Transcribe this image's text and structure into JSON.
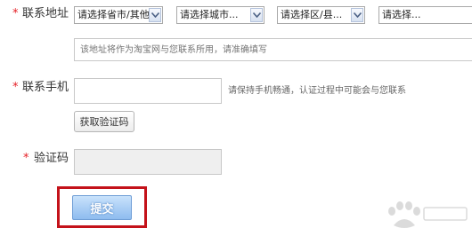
{
  "colors": {
    "required_mark": "#e51c23",
    "highlight_border": "#c4121a",
    "submit_bg": "#8ebcef"
  },
  "address": {
    "required_mark": "*",
    "label": "联系地址",
    "province_select": "请选择省市/其他",
    "city_select": "请选择城市...",
    "district_select": "请选择区/县...",
    "street_select": "请选择...",
    "detail_placeholder": "该地址将作为淘宝网与您联系所用，请准确填写"
  },
  "phone": {
    "required_mark": "*",
    "label": "联系手机",
    "value": "",
    "hint": "请保持手机畅通，认证过程中可能会与您联系",
    "get_code_button": "获取验证码"
  },
  "code": {
    "required_mark": "*",
    "label": "验证码",
    "value": ""
  },
  "submit": {
    "label": "提交"
  }
}
